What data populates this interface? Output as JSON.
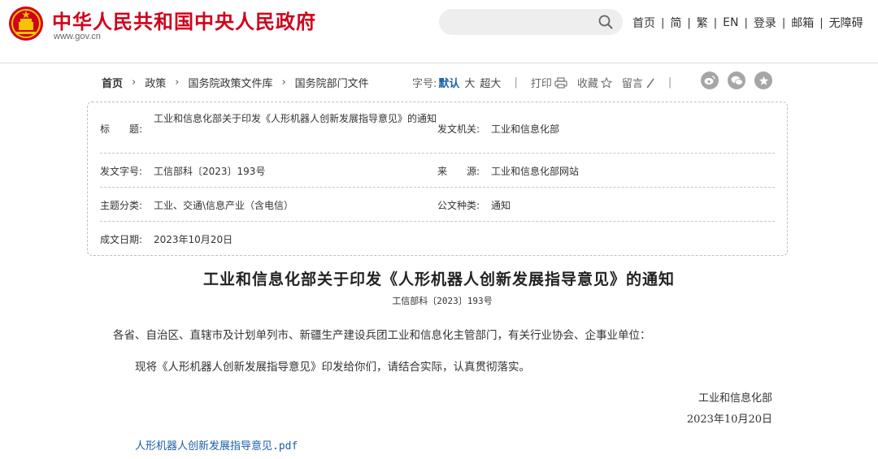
{
  "header": {
    "site_name": "中华人民共和国中央人民政府",
    "site_domain": "www.gov.cn",
    "search_placeholder": "",
    "nav": [
      "首页",
      "简",
      "繁",
      "EN",
      "登录",
      "邮箱",
      "无障碍"
    ],
    "colors": {
      "brand_red": "#d0021b",
      "link_blue": "#1a5ea8"
    }
  },
  "breadcrumb": [
    "首页",
    "政策",
    "国务院政策文件库",
    "国务院部门文件"
  ],
  "tools": {
    "font_size_label": "字号:",
    "font_default": "默认",
    "font_large": "大",
    "font_xlarge": "超大",
    "print": "打印",
    "favorite": "收藏",
    "comment": "留言",
    "share_icons": [
      "weibo-icon",
      "wechat-icon",
      "star-icon"
    ]
  },
  "info": {
    "title_label": "标　　题:",
    "title_value": "工业和信息化部关于印发《人形机器人创新发展指导意见》的通知",
    "issuer_label": "发文机关:",
    "issuer_value": "工业和信息化部",
    "doc_no_label": "发文字号:",
    "doc_no_value": "工信部科〔2023〕193号",
    "source_label": "来　　源:",
    "source_value": "工业和信息化部网站",
    "category_label": "主题分类:",
    "category_value": "工业、交通\\信息产业（含电信）",
    "type_label": "公文种类:",
    "type_value": "通知",
    "date_label": "成文日期:",
    "date_value": "2023年10月20日"
  },
  "document": {
    "title": "工业和信息化部关于印发《人形机器人创新发展指导意见》的通知",
    "number": "工信部科〔2023〕193号",
    "salutation": "各省、自治区、直辖市及计划单列市、新疆生产建设兵团工业和信息化主管部门，有关行业协会、企事业单位：",
    "body": "现将《人形机器人创新发展指导意见》印发给你们，请结合实际，认真贯彻落实。",
    "signer": "工业和信息化部",
    "sign_date": "2023年10月20日",
    "attachment": "人形机器人创新发展指导意见.pdf"
  }
}
